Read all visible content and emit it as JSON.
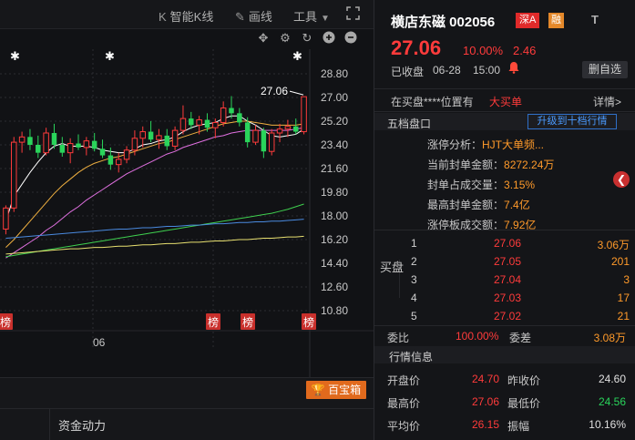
{
  "toolbar": {
    "smart_k_label": "智能K线",
    "draw_label": "画线",
    "tools_label": "工具"
  },
  "chart_data": {
    "type": "candlestick",
    "y_ticks": [
      "28.80",
      "27.00",
      "25.20",
      "23.40",
      "21.60",
      "19.80",
      "18.00",
      "16.20",
      "14.40",
      "12.60",
      "10.80"
    ],
    "ylim": [
      10.8,
      28.8
    ],
    "x_label": "06",
    "last_price_label": "27.06",
    "bang_labels": [
      "榜",
      "榜",
      "榜",
      "榜"
    ],
    "candles": [
      {
        "o": 17.0,
        "h": 18.8,
        "l": 16.6,
        "c": 18.6
      },
      {
        "o": 18.6,
        "h": 24.0,
        "l": 18.3,
        "c": 23.6
      },
      {
        "o": 23.6,
        "h": 24.4,
        "l": 22.8,
        "c": 24.0
      },
      {
        "o": 24.0,
        "h": 24.6,
        "l": 23.0,
        "c": 23.4
      },
      {
        "o": 23.4,
        "h": 24.1,
        "l": 22.4,
        "c": 22.8
      },
      {
        "o": 22.8,
        "h": 24.7,
        "l": 22.6,
        "c": 24.3
      },
      {
        "o": 24.3,
        "h": 25.0,
        "l": 23.1,
        "c": 23.4
      },
      {
        "o": 23.4,
        "h": 24.0,
        "l": 22.5,
        "c": 22.8
      },
      {
        "o": 22.8,
        "h": 23.9,
        "l": 22.0,
        "c": 23.5
      },
      {
        "o": 23.5,
        "h": 24.2,
        "l": 23.0,
        "c": 23.2
      },
      {
        "o": 23.2,
        "h": 24.0,
        "l": 22.6,
        "c": 23.7
      },
      {
        "o": 23.7,
        "h": 24.3,
        "l": 22.9,
        "c": 23.1
      },
      {
        "o": 23.1,
        "h": 23.8,
        "l": 22.4,
        "c": 22.6
      },
      {
        "o": 22.6,
        "h": 23.2,
        "l": 21.5,
        "c": 21.9
      },
      {
        "o": 21.9,
        "h": 22.8,
        "l": 21.3,
        "c": 22.3
      },
      {
        "o": 22.3,
        "h": 23.3,
        "l": 22.0,
        "c": 23.0
      },
      {
        "o": 23.0,
        "h": 24.5,
        "l": 22.6,
        "c": 23.9
      },
      {
        "o": 23.9,
        "h": 24.8,
        "l": 23.2,
        "c": 24.4
      },
      {
        "o": 24.4,
        "h": 25.2,
        "l": 23.6,
        "c": 23.8
      },
      {
        "o": 23.8,
        "h": 24.6,
        "l": 23.1,
        "c": 24.1
      },
      {
        "o": 24.1,
        "h": 24.6,
        "l": 23.0,
        "c": 23.3
      },
      {
        "o": 23.3,
        "h": 24.8,
        "l": 23.0,
        "c": 24.5
      },
      {
        "o": 24.5,
        "h": 26.4,
        "l": 24.2,
        "c": 25.4
      },
      {
        "o": 25.4,
        "h": 25.9,
        "l": 24.6,
        "c": 24.9
      },
      {
        "o": 24.9,
        "h": 25.6,
        "l": 24.2,
        "c": 25.3
      },
      {
        "o": 25.3,
        "h": 25.8,
        "l": 24.4,
        "c": 24.7
      },
      {
        "o": 24.7,
        "h": 25.4,
        "l": 23.9,
        "c": 25.1
      },
      {
        "o": 25.1,
        "h": 26.7,
        "l": 24.8,
        "c": 26.2
      },
      {
        "o": 26.2,
        "h": 27.1,
        "l": 25.4,
        "c": 25.8
      },
      {
        "o": 25.8,
        "h": 26.2,
        "l": 24.8,
        "c": 25.1
      },
      {
        "o": 25.1,
        "h": 25.5,
        "l": 23.2,
        "c": 23.6
      },
      {
        "o": 23.6,
        "h": 24.9,
        "l": 23.4,
        "c": 24.5
      },
      {
        "o": 24.5,
        "h": 24.7,
        "l": 22.4,
        "c": 22.9
      },
      {
        "o": 22.9,
        "h": 24.6,
        "l": 22.6,
        "c": 24.3
      },
      {
        "o": 24.3,
        "h": 25.0,
        "l": 23.6,
        "c": 24.6
      },
      {
        "o": 24.6,
        "h": 25.3,
        "l": 24.0,
        "c": 24.8
      },
      {
        "o": 24.8,
        "h": 25.4,
        "l": 24.2,
        "c": 24.4
      },
      {
        "o": 24.4,
        "h": 27.06,
        "l": 24.2,
        "c": 27.06
      }
    ],
    "ma_series": [
      {
        "color": "#ffffff",
        "values": [
          17.6,
          19.5,
          20.4,
          21.3,
          22.1,
          22.8,
          23.3,
          23.5,
          23.3,
          23.3,
          23.3,
          23.2,
          23.0,
          22.9,
          22.8,
          22.8,
          23.1,
          23.4,
          23.5,
          23.7,
          23.8,
          24.0,
          24.4,
          24.7,
          24.9,
          25.0,
          25.1,
          25.4,
          25.6,
          25.6,
          25.2,
          24.9,
          24.5,
          24.1,
          24.0,
          24.1,
          24.2,
          24.6
        ]
      },
      {
        "color": "#f0b040",
        "values": [
          15.6,
          16.2,
          16.9,
          17.6,
          18.3,
          19.0,
          19.7,
          20.3,
          20.8,
          21.3,
          21.7,
          22.0,
          22.2,
          22.4,
          22.5,
          22.7,
          22.9,
          23.1,
          23.3,
          23.5,
          23.6,
          23.8,
          24.0,
          24.2,
          24.4,
          24.6,
          24.8,
          25.0,
          25.1,
          25.2,
          25.2,
          25.1,
          25.0,
          24.9,
          24.9,
          24.9,
          24.9,
          25.0
        ]
      },
      {
        "color": "#e070e0",
        "values": [
          14.8,
          15.2,
          15.6,
          16.0,
          16.4,
          16.9,
          17.3,
          17.8,
          18.3,
          18.7,
          19.2,
          19.6,
          20.0,
          20.4,
          20.8,
          21.2,
          21.5,
          21.8,
          22.1,
          22.4,
          22.7,
          22.9,
          23.2,
          23.4,
          23.6,
          23.8,
          24.0,
          24.1,
          24.3,
          24.4,
          24.5,
          24.5,
          24.5,
          24.5,
          24.5,
          24.5,
          24.6,
          24.7
        ]
      },
      {
        "color": "#3fd04f",
        "values": [
          14.9,
          15.0,
          15.1,
          15.2,
          15.3,
          15.4,
          15.5,
          15.6,
          15.7,
          15.8,
          15.9,
          16.0,
          16.1,
          16.2,
          16.3,
          16.4,
          16.5,
          16.6,
          16.7,
          16.8,
          16.9,
          17.0,
          17.1,
          17.2,
          17.3,
          17.4,
          17.5,
          17.6,
          17.7,
          17.8,
          17.9,
          18.0,
          18.1,
          18.2,
          18.35,
          18.5,
          18.7,
          18.9
        ]
      },
      {
        "color": "#4a8ae0",
        "values": [
          16.3,
          16.35,
          16.4,
          16.45,
          16.5,
          16.55,
          16.6,
          16.65,
          16.7,
          16.75,
          16.8,
          16.85,
          16.9,
          16.95,
          17.0,
          17.0,
          17.05,
          17.1,
          17.1,
          17.15,
          17.2,
          17.2,
          17.25,
          17.3,
          17.3,
          17.35,
          17.4,
          17.4,
          17.45,
          17.5,
          17.5,
          17.55,
          17.55,
          17.6,
          17.6,
          17.65,
          17.7,
          17.75
        ]
      },
      {
        "color": "#e8e070",
        "values": [
          15.1,
          15.15,
          15.2,
          15.25,
          15.3,
          15.35,
          15.4,
          15.45,
          15.5,
          15.5,
          15.55,
          15.6,
          15.6,
          15.65,
          15.7,
          15.7,
          15.75,
          15.8,
          15.8,
          15.85,
          15.9,
          15.9,
          15.95,
          16.0,
          16.0,
          16.05,
          16.1,
          16.1,
          16.15,
          16.2,
          16.2,
          16.25,
          16.3,
          16.3,
          16.35,
          16.4,
          16.4,
          16.45
        ]
      }
    ]
  },
  "bottom": {
    "baobao_label": "百宝箱",
    "zijin_label": "资金动力"
  },
  "header": {
    "name": "横店东磁 002056",
    "market_badge": "深A",
    "margin_badge": "融",
    "t_label": "T"
  },
  "quote": {
    "price": "27.06",
    "pct": "10.00%",
    "change": "2.46",
    "status": "已收盘",
    "date": "06-28",
    "time": "15:00",
    "remove_watch": "删自选"
  },
  "buying": {
    "text": "在买盘****位置有",
    "big": "大买单",
    "detail": "详情>"
  },
  "wudang": {
    "title": "五档盘口",
    "upgrade": "升级到十档行情",
    "info": [
      {
        "label": "涨停分析：",
        "value": "HJT大单频..."
      },
      {
        "label": "当前封单金额：",
        "value": "8272.24万"
      },
      {
        "label": "封单占成交量：",
        "value": "3.15%"
      },
      {
        "label": "最高封单金额：",
        "value": "7.4亿"
      },
      {
        "label": "涨停板成交额：",
        "value": "7.92亿"
      }
    ],
    "buy_label": "买盘",
    "bids": [
      {
        "idx": "1",
        "price": "27.06",
        "vol": "3.06万"
      },
      {
        "idx": "2",
        "price": "27.05",
        "vol": "201"
      },
      {
        "idx": "3",
        "price": "27.04",
        "vol": "3"
      },
      {
        "idx": "4",
        "price": "27.03",
        "vol": "17"
      },
      {
        "idx": "5",
        "price": "27.02",
        "vol": "21"
      }
    ],
    "weibi_label": "委比",
    "weibi_value": "100.00%",
    "weicha_label": "委差",
    "weicha_value": "3.08万"
  },
  "quote_info": {
    "title": "行情信息",
    "rows": [
      {
        "l1": "开盘价",
        "v1": "24.70",
        "l2": "昨收价",
        "v2": "24.60",
        "cls": "white"
      },
      {
        "l1": "最高价",
        "v1": "27.06",
        "l2": "最低价",
        "v2": "24.56",
        "cls": "green"
      },
      {
        "l1": "平均价",
        "v1": "26.15",
        "l2": "振幅",
        "v2": "10.16%",
        "cls": "white"
      }
    ]
  }
}
